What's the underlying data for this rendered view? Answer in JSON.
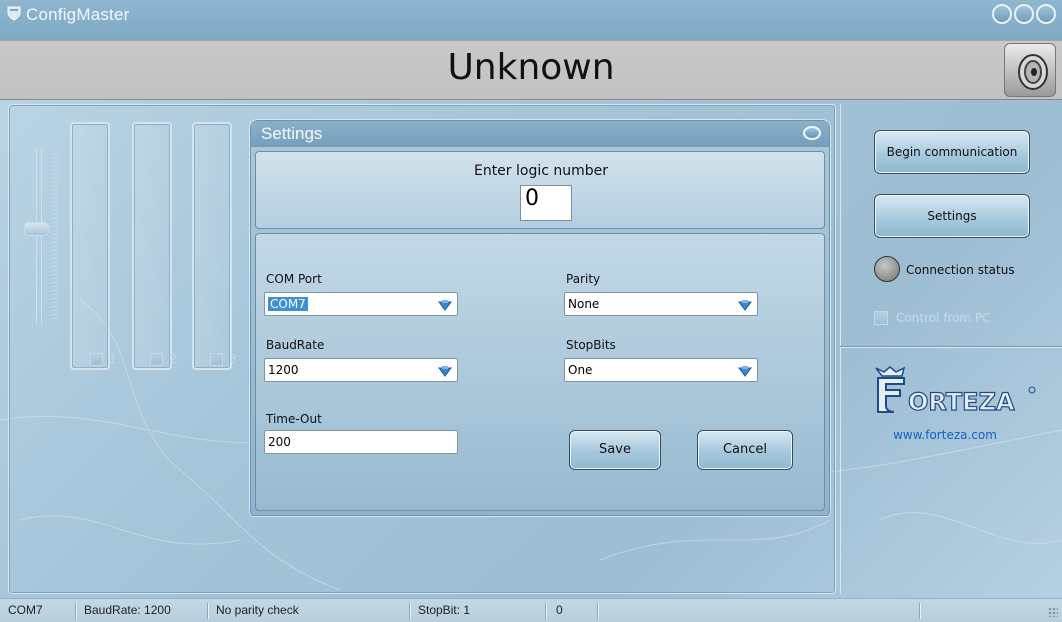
{
  "window": {
    "title": "ConfigMaster",
    "banner_title": "Unknown"
  },
  "left_panel": {
    "channels": [
      {
        "label": "1"
      },
      {
        "label": "2"
      },
      {
        "label": "3"
      }
    ]
  },
  "settings_dialog": {
    "title": "Settings",
    "logic_label": "Enter logic number",
    "logic_value": "0",
    "com_port": {
      "label": "COM Port",
      "value": "COM7"
    },
    "parity": {
      "label": "Parity",
      "value": "None"
    },
    "baudrate": {
      "label": "BaudRate",
      "value": "1200"
    },
    "stopbits": {
      "label": "StopBits",
      "value": "One"
    },
    "timeout": {
      "label": "Time-Out",
      "value": "200"
    },
    "save_label": "Save",
    "cancel_label": "Cancel"
  },
  "right_panel": {
    "begin_label": "Begin communication",
    "settings_label": "Settings",
    "connection_status_label": "Connection status",
    "control_from_pc_label": "Control from PC",
    "website": "www.forteza.com"
  },
  "statusbar": {
    "port": "COM7",
    "baudrate": "BaudRate: 1200",
    "parity": "No parity check",
    "stopbit": "StopBit: 1",
    "value": "0"
  },
  "colors": {
    "accent": "#8fb6cf",
    "link": "#1560c8",
    "selection": "#3d8fd6"
  }
}
